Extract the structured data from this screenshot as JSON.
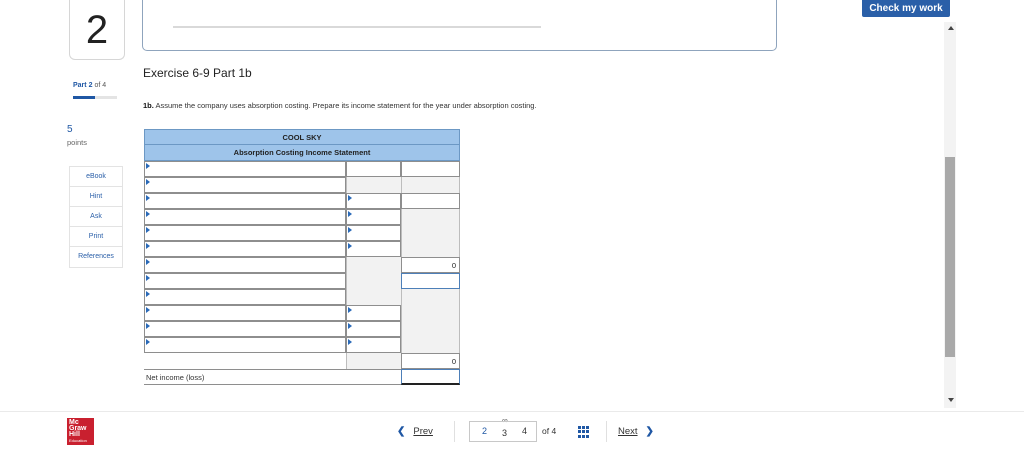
{
  "header": {
    "check_button": "Check my work"
  },
  "sidebar": {
    "question_number": "2",
    "part_word": "Part",
    "part_current": "2",
    "part_of": "of 4",
    "part_progress": 0.5,
    "points_value": "5",
    "points_label": "points",
    "links": [
      {
        "label": "eBook"
      },
      {
        "label": "Hint"
      },
      {
        "label": "Ask"
      },
      {
        "label": "Print"
      },
      {
        "label": "References"
      }
    ]
  },
  "main": {
    "exercise_title": "Exercise 6-9 Part 1b",
    "instruction_bold": "1b.",
    "instruction_text": " Assume the company uses absorption costing. Prepare its income statement for the year under absorption costing."
  },
  "statement": {
    "company": "COOL SKY",
    "title": "Absorption Costing Income Statement",
    "total_1": "0",
    "total_2": "0",
    "net_income_label": "Net income (loss)"
  },
  "footer": {
    "prev_label": "Prev",
    "next_label": "Next",
    "pages": [
      "2",
      "3",
      "4"
    ],
    "current_page": "3",
    "of_total": "of 4"
  },
  "colors": {
    "accent": "#1f57a4",
    "table_header": "#9ec4ea",
    "logo": "#c9202f"
  }
}
